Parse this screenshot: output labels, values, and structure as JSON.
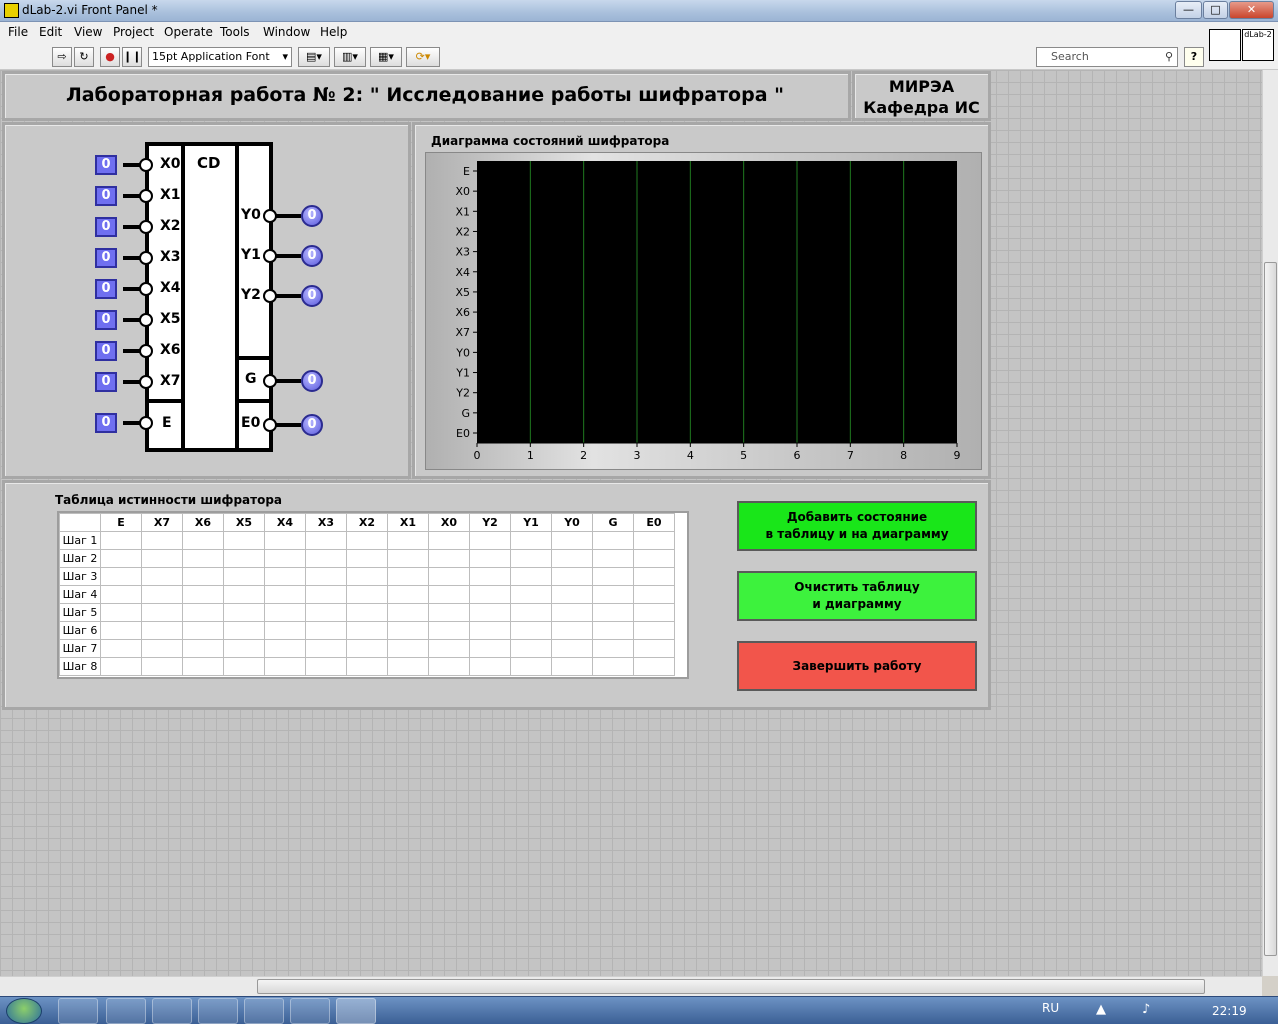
{
  "window": {
    "title": "dLab-2.vi Front Panel *"
  },
  "menu": [
    "File",
    "Edit",
    "View",
    "Project",
    "Operate",
    "Tools",
    "Window",
    "Help"
  ],
  "toolbar": {
    "font": "15pt Application Font",
    "search_placeholder": "Search",
    "help": "?",
    "vi_icon_label": "dLab-2"
  },
  "header": {
    "title": "Лабораторная работа № 2: \" Исследование работы шифратора \"",
    "org_line1": "МИРЭА",
    "org_line2": "Кафедра ИС"
  },
  "encoder": {
    "block_label": "CD",
    "inputs": [
      {
        "label": "X0",
        "value": "0"
      },
      {
        "label": "X1",
        "value": "0"
      },
      {
        "label": "X2",
        "value": "0"
      },
      {
        "label": "X3",
        "value": "0"
      },
      {
        "label": "X4",
        "value": "0"
      },
      {
        "label": "X5",
        "value": "0"
      },
      {
        "label": "X6",
        "value": "0"
      },
      {
        "label": "X7",
        "value": "0"
      }
    ],
    "enable": {
      "label": "E",
      "value": "0"
    },
    "outputs": [
      {
        "label": "Y0",
        "value": "0"
      },
      {
        "label": "Y1",
        "value": "0"
      },
      {
        "label": "Y2",
        "value": "0"
      }
    ],
    "group": {
      "label": "G",
      "value": "0"
    },
    "enable_out": {
      "label": "E0",
      "value": "0"
    }
  },
  "diagram": {
    "title": "Диаграмма состояний шифратора",
    "y_labels": [
      "E",
      "X0",
      "X1",
      "X2",
      "X3",
      "X4",
      "X5",
      "X6",
      "X7",
      "Y0",
      "Y1",
      "Y2",
      "G",
      "E0"
    ],
    "x_ticks": [
      "0",
      "1",
      "2",
      "3",
      "4",
      "5",
      "6",
      "7",
      "8",
      "9"
    ]
  },
  "chart_data": {
    "type": "line",
    "title": "Диаграмма состояний шифратора",
    "categories": [
      "E",
      "X0",
      "X1",
      "X2",
      "X3",
      "X4",
      "X5",
      "X6",
      "X7",
      "Y0",
      "Y1",
      "Y2",
      "G",
      "E0"
    ],
    "xlim": [
      0,
      9
    ],
    "x_ticks": [
      0,
      1,
      2,
      3,
      4,
      5,
      6,
      7,
      8,
      9
    ],
    "series": [],
    "grid": "vertical",
    "background": "#000000",
    "grid_color": "#1f7a1f"
  },
  "table": {
    "title": "Таблица истинности шифратора",
    "columns": [
      "E",
      "X7",
      "X6",
      "X5",
      "X4",
      "X3",
      "X2",
      "X1",
      "X0",
      "Y2",
      "Y1",
      "Y0",
      "G",
      "E0"
    ],
    "rows": [
      "Шаг 1",
      "Шаг 2",
      "Шаг 3",
      "Шаг 4",
      "Шаг 5",
      "Шаг 6",
      "Шаг 7",
      "Шаг 8"
    ]
  },
  "buttons": {
    "add_line1": "Добавить состояние",
    "add_line2": "в таблицу и на диаграмму",
    "clear_line1": "Очистить таблицу",
    "clear_line2": "и диаграмму",
    "finish": "Завершить работу"
  },
  "taskbar": {
    "lang": "RU",
    "time": "22:19"
  },
  "colors": {
    "add_button": "#19e619",
    "clear_button": "#3df23d",
    "finish_button": "#f2554b",
    "control": "#6f6ff0"
  }
}
